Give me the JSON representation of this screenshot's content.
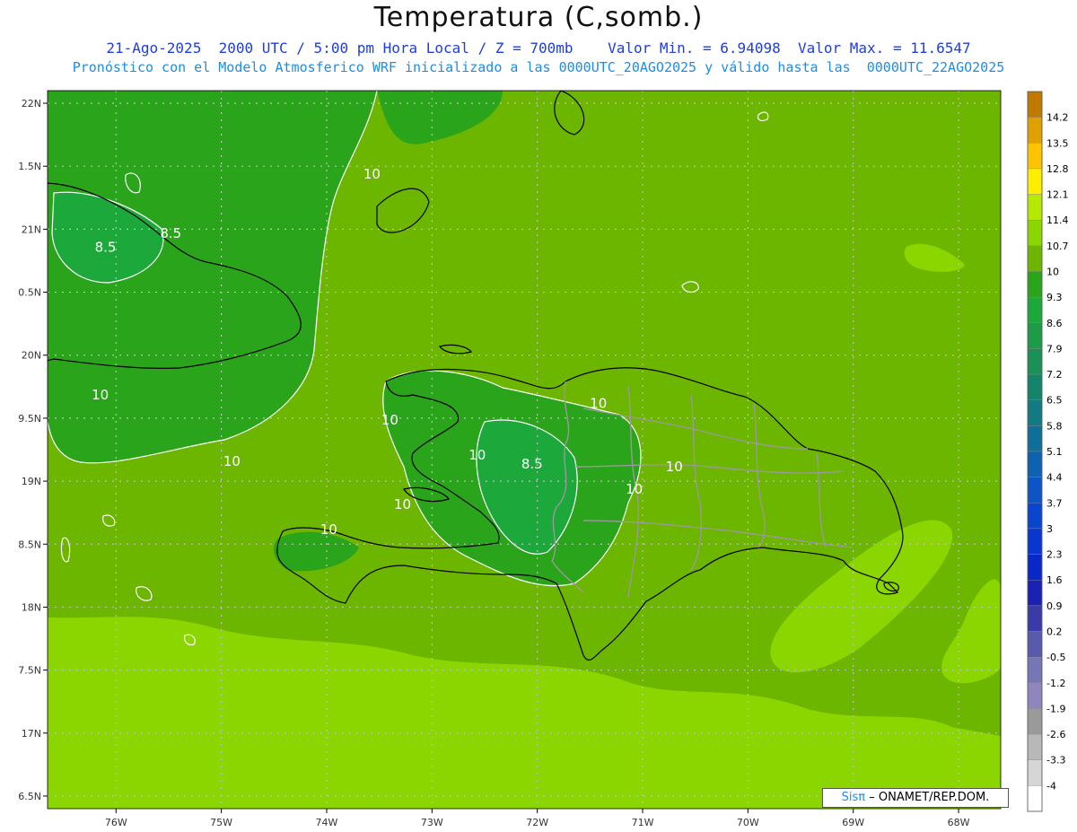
{
  "header": {
    "title": "Temperatura (C,somb.)",
    "subtitle1": "21-Ago-2025  2000 UTC / 5:00 pm Hora Local / Z = 700mb    Valor Min. = 6.94098  Valor Max. = 11.6547",
    "subtitle2": "Pronóstico con el Modelo Atmosferico WRF inicializado a las 0000UTC_20AGO2025 y válido hasta las  0000UTC_22AGO2025"
  },
  "credit": {
    "brand": "Sisπ",
    "text": "– ONAMET/REP.DOM."
  },
  "map": {
    "lon_range": [
      -76.65,
      -67.6
    ],
    "lat_range": [
      16.4,
      22.1
    ],
    "lon_ticks": [
      {
        "v": -76,
        "label": "76W"
      },
      {
        "v": -75,
        "label": "75W"
      },
      {
        "v": -74,
        "label": "74W"
      },
      {
        "v": -73,
        "label": "73W"
      },
      {
        "v": -72,
        "label": "72W"
      },
      {
        "v": -71,
        "label": "71W"
      },
      {
        "v": -70,
        "label": "70W"
      },
      {
        "v": -69,
        "label": "69W"
      },
      {
        "v": -68,
        "label": "68W"
      }
    ],
    "lat_ticks": [
      {
        "v": 22,
        "label": "22N"
      },
      {
        "v": 21.5,
        "label": "1.5N"
      },
      {
        "v": 21,
        "label": "21N"
      },
      {
        "v": 20.5,
        "label": "0.5N"
      },
      {
        "v": 20,
        "label": "20N"
      },
      {
        "v": 19.5,
        "label": "9.5N"
      },
      {
        "v": 19,
        "label": "19N"
      },
      {
        "v": 18.5,
        "label": "8.5N"
      },
      {
        "v": 18,
        "label": "18N"
      },
      {
        "v": 17.5,
        "label": "7.5N"
      },
      {
        "v": 17,
        "label": "17N"
      },
      {
        "v": 16.5,
        "label": "6.5N"
      }
    ],
    "contour_labels": [
      {
        "text": "8.5",
        "lon": -75.48,
        "lat": 20.93
      },
      {
        "text": "8.5",
        "lon": -76.1,
        "lat": 20.82
      },
      {
        "text": "10",
        "lon": -73.57,
        "lat": 21.4
      },
      {
        "text": "10",
        "lon": -76.15,
        "lat": 19.65
      },
      {
        "text": "10",
        "lon": -74.9,
        "lat": 19.12
      },
      {
        "text": "10",
        "lon": -73.4,
        "lat": 19.45
      },
      {
        "text": "10",
        "lon": -72.57,
        "lat": 19.17
      },
      {
        "text": "8.5",
        "lon": -72.05,
        "lat": 19.1
      },
      {
        "text": "10",
        "lon": -71.42,
        "lat": 19.58
      },
      {
        "text": "10",
        "lon": -70.7,
        "lat": 19.08
      },
      {
        "text": "10",
        "lon": -71.08,
        "lat": 18.9
      },
      {
        "text": "10",
        "lon": -73.28,
        "lat": 18.78
      },
      {
        "text": "10",
        "lon": -73.98,
        "lat": 18.58
      }
    ]
  },
  "colorbar": {
    "levels": [
      {
        "label": "14.2",
        "color": "#c07a00"
      },
      {
        "label": "13.5",
        "color": "#e0a000"
      },
      {
        "label": "12.8",
        "color": "#ffc400"
      },
      {
        "label": "12.1",
        "color": "#ffee00"
      },
      {
        "label": "11.4",
        "color": "#b5ea00"
      },
      {
        "label": "10.7",
        "color": "#8bd600"
      },
      {
        "label": "10",
        "color": "#6cb600"
      },
      {
        "label": "9.3",
        "color": "#2aa41b"
      },
      {
        "label": "8.6",
        "color": "#1ca83a"
      },
      {
        "label": "7.9",
        "color": "#1e9a48"
      },
      {
        "label": "7.2",
        "color": "#1b9158"
      },
      {
        "label": "6.5",
        "color": "#14846b"
      },
      {
        "label": "5.8",
        "color": "#127a80"
      },
      {
        "label": "5.1",
        "color": "#106f98"
      },
      {
        "label": "4.4",
        "color": "#0f62b0"
      },
      {
        "label": "3.7",
        "color": "#0d55c4"
      },
      {
        "label": "3",
        "color": "#0a45cf"
      },
      {
        "label": "2.3",
        "color": "#0a36d0"
      },
      {
        "label": "1.6",
        "color": "#0a28c8"
      },
      {
        "label": "0.9",
        "color": "#1a22b4"
      },
      {
        "label": "0.2",
        "color": "#3a3aa8"
      },
      {
        "label": "-0.5",
        "color": "#5a5aac"
      },
      {
        "label": "-1.2",
        "color": "#7777b8"
      },
      {
        "label": "-1.9",
        "color": "#9085bc"
      },
      {
        "label": "-2.6",
        "color": "#9a9a9a"
      },
      {
        "label": "-3.3",
        "color": "#b8b8b8"
      },
      {
        "label": "-4",
        "color": "#d6d6d6"
      },
      {
        "label": "",
        "color": "#ffffff"
      }
    ]
  },
  "colors": {
    "base": "#6cb600",
    "light": "#8bd600",
    "mid": "#2aa41b",
    "dark": "#1ca83a",
    "grid": "#bfbfbf",
    "coast": "#000000",
    "border": "#999999",
    "contour": "#ffffff"
  }
}
